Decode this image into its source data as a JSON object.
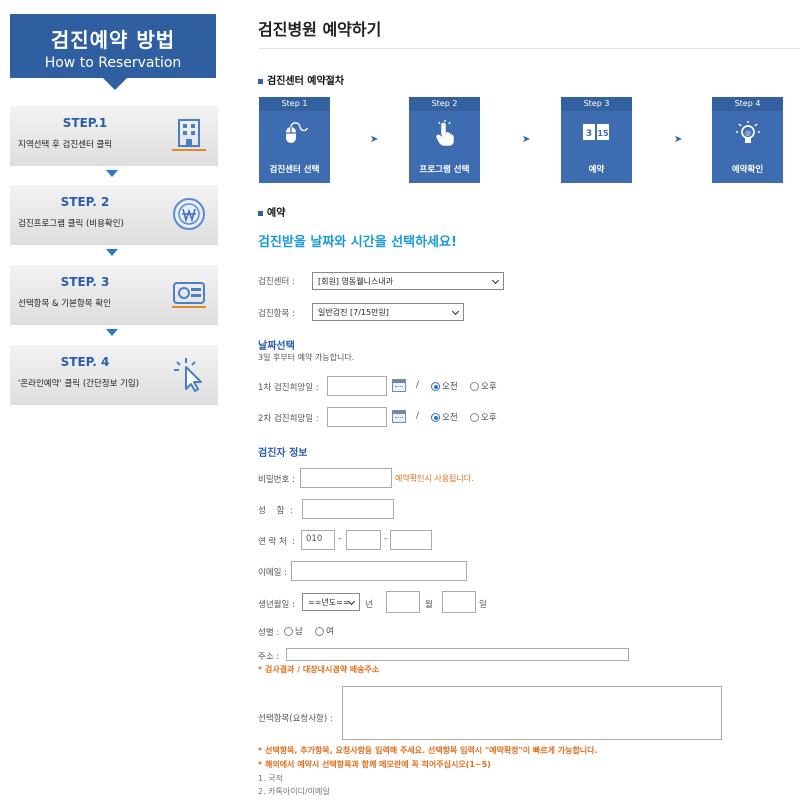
{
  "sidebar": {
    "title": "검진예약 방법",
    "subtitle": "How to Reservation",
    "steps": [
      {
        "title": "STEP.1",
        "desc": "지역선택 후 검진센터 클릭",
        "icon": "hospital-building-icon"
      },
      {
        "title": "STEP. 2",
        "desc": "검진프로그램 클릭 (비용확인)",
        "icon": "won-coin-icon"
      },
      {
        "title": "STEP. 3",
        "desc": "선택항목 & 기본항목 확인",
        "icon": "medical-scanner-icon"
      },
      {
        "title": "STEP. 4",
        "desc": "'온라인예약' 클릭 (간단정보 기입)",
        "icon": "cursor-click-icon"
      }
    ]
  },
  "main": {
    "title": "검진병원 예약하기",
    "process": {
      "heading": "검진센터 예약절차",
      "steps": [
        {
          "step": "Step 1",
          "label": "검진센터 선택",
          "icon": "mouse-icon"
        },
        {
          "step": "Step 2",
          "label": "프로그램 선택",
          "icon": "hand-pointer-icon"
        },
        {
          "step": "Step 3",
          "label": "예약",
          "icon": "calendar-3-15-icon"
        },
        {
          "step": "Step 4",
          "label": "예약확인",
          "icon": "lightbulb-icon"
        }
      ],
      "arrow": "➤",
      "cal_left": "3",
      "cal_right": "15"
    },
    "reservation": {
      "heading": "예약",
      "headline": "검진받을 날짜와 시간을 선택하세요!",
      "center_label": "검진센터 :",
      "center_value": "[회원] 영동웰니스내과",
      "item_label": "검진항목 :",
      "item_value": "일반검진 [7/15만원]",
      "date_heading": "날짜선택",
      "date_note": "3일 후부터 예약 가능합니다.",
      "date1_label": "1차 검진희망일 :",
      "date2_label": "2차 검진희망일 :",
      "slash": "/",
      "am": "오전",
      "pm": "오후"
    },
    "patient": {
      "heading": "검진자 정보",
      "password_label": "비밀번호 :",
      "password_note": "예약확인시 사용됩니다.",
      "name_label": "성    함  :",
      "phone_label": "연 락 처  :",
      "phone_prefix": "010",
      "dash": "-",
      "email_label": "이메일 :",
      "birth_label": "생년월일 :",
      "year_select": "==년도==",
      "year_unit": "년",
      "month_unit": "월",
      "day_unit": "일",
      "gender_label": "성별 :",
      "male": "남",
      "female": "여",
      "address_label": "주소 :",
      "address_note": "* 검사결과 / 대장내시경약 배송주소",
      "request_label": "선택항목(요청사항) :",
      "note1": "* 선택항목, 추가항목, 요청사항등 입력해 주세요. 선택항목 입력시 \"예약확정\"이 빠르게 가능합니다.",
      "note2": "* 해외에서 예약시 선택항목과 함께 메모란에 꼭 적어주십시오(1~5)",
      "list1": "1. 국적",
      "list2": "2. 카톡아이디/이메일"
    }
  }
}
